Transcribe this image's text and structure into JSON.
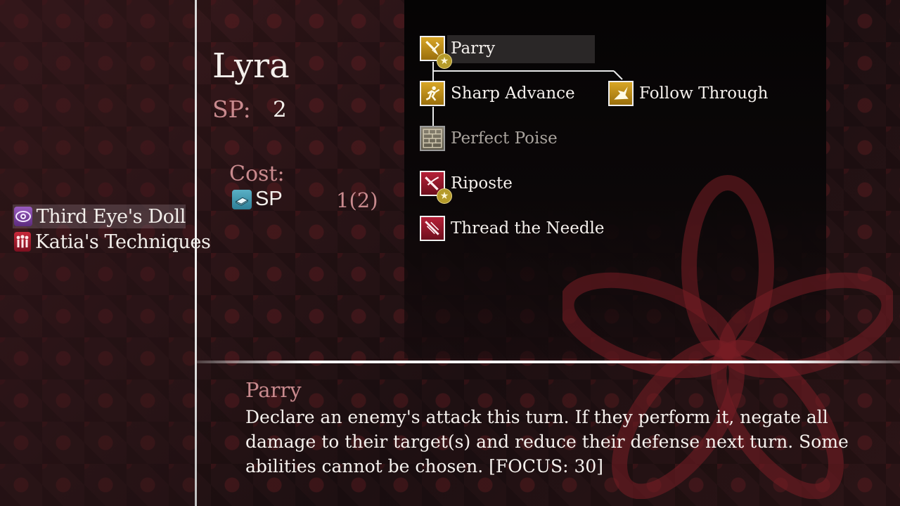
{
  "party": [
    {
      "name": "Third Eye's Doll",
      "icon": "eye-icon",
      "selected": true
    },
    {
      "name": "Katia's Techniques",
      "icon": "people-icon",
      "selected": false
    }
  ],
  "character": {
    "name": "Lyra",
    "sp_label": "SP:",
    "sp_value": "2"
  },
  "cost": {
    "label": "Cost:",
    "type": "SP",
    "amount": "1(2)",
    "icon": "book-icon"
  },
  "skill_tree": [
    {
      "label": "Parry",
      "icon": "sword-parry-icon",
      "color": "gold",
      "starred": true,
      "selected": true
    },
    {
      "label": "Sharp Advance",
      "icon": "running-figure-icon",
      "color": "gold",
      "starred": false
    },
    {
      "label": "Follow Through",
      "icon": "burst-slash-icon",
      "color": "gold",
      "starred": false
    },
    {
      "label": "Perfect Poise",
      "icon": "brick-wall-icon",
      "color": "locked",
      "starred": false
    },
    {
      "label": "Riposte",
      "icon": "crossed-blade-icon",
      "color": "red",
      "starred": true
    },
    {
      "label": "Thread the Needle",
      "icon": "needle-thrust-icon",
      "color": "red",
      "starred": false
    }
  ],
  "description": {
    "title": "Parry",
    "text": "Declare an enemy's attack this turn. If they perform it, negate all damage to their target(s) and reduce their defense next turn. Some abilities cannot be chosen. [FOCUS: 30]"
  },
  "colors": {
    "accent_pink": "#c98a8e",
    "gold": "#d8a626",
    "red": "#b52038",
    "background": "#2a1416"
  }
}
